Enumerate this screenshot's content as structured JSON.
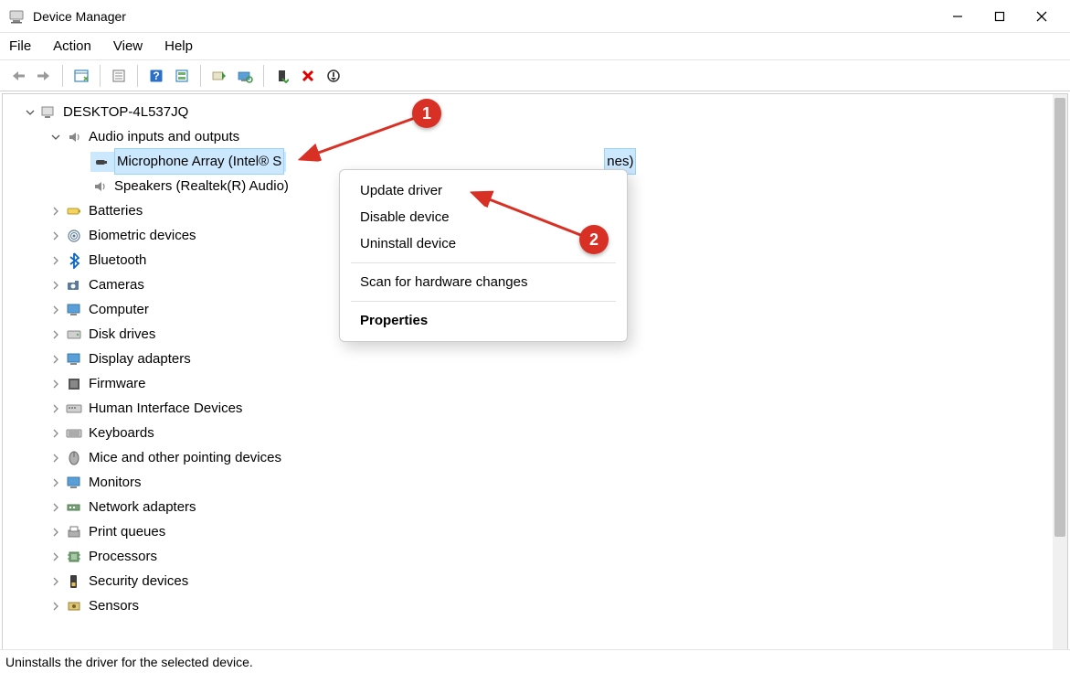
{
  "window": {
    "title": "Device Manager"
  },
  "menubar": {
    "file": "File",
    "action": "Action",
    "view": "View",
    "help": "Help"
  },
  "tree": {
    "root": "DESKTOP-4L537JQ",
    "audio": {
      "label": "Audio inputs and outputs",
      "microphone": "Microphone Array (Intel® S",
      "microphone_suffix": "nes)",
      "speakers": "Speakers (Realtek(R) Audio)"
    },
    "categories": [
      "Batteries",
      "Biometric devices",
      "Bluetooth",
      "Cameras",
      "Computer",
      "Disk drives",
      "Display adapters",
      "Firmware",
      "Human Interface Devices",
      "Keyboards",
      "Mice and other pointing devices",
      "Monitors",
      "Network adapters",
      "Print queues",
      "Processors",
      "Security devices",
      "Sensors"
    ]
  },
  "context_menu": {
    "update": "Update driver",
    "disable": "Disable device",
    "uninstall": "Uninstall device",
    "scan": "Scan for hardware changes",
    "properties": "Properties"
  },
  "statusbar": {
    "text": "Uninstalls the driver for the selected device."
  },
  "annotations": {
    "marker1": "1",
    "marker2": "2"
  }
}
